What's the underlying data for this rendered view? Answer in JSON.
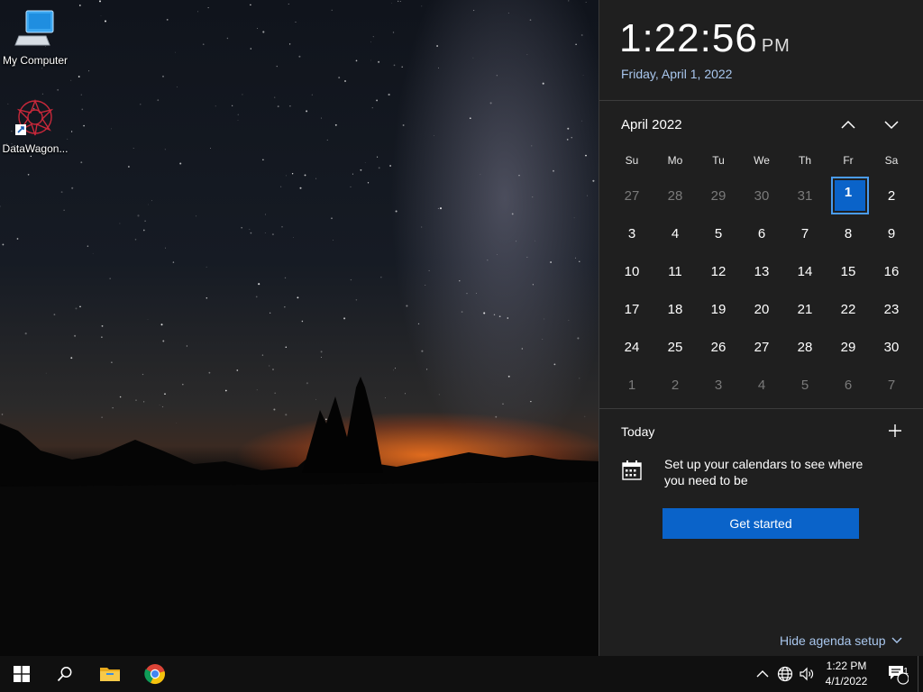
{
  "desktop": {
    "icons": [
      {
        "label": "My Computer",
        "icon": "computer-icon"
      },
      {
        "label": "DataWagon...",
        "icon": "datawagon-icon"
      }
    ]
  },
  "flyout": {
    "time": "1:22:56",
    "ampm": "PM",
    "date_long": "Friday, April 1, 2022",
    "month_label": "April 2022",
    "days_of_week": [
      "Su",
      "Mo",
      "Tu",
      "We",
      "Th",
      "Fr",
      "Sa"
    ],
    "weeks": [
      [
        {
          "d": "27",
          "m": true
        },
        {
          "d": "28",
          "m": true
        },
        {
          "d": "29",
          "m": true
        },
        {
          "d": "30",
          "m": true
        },
        {
          "d": "31",
          "m": true
        },
        {
          "d": "1",
          "t": true
        },
        {
          "d": "2"
        }
      ],
      [
        {
          "d": "3"
        },
        {
          "d": "4"
        },
        {
          "d": "5"
        },
        {
          "d": "6"
        },
        {
          "d": "7"
        },
        {
          "d": "8"
        },
        {
          "d": "9"
        }
      ],
      [
        {
          "d": "10"
        },
        {
          "d": "11"
        },
        {
          "d": "12"
        },
        {
          "d": "13"
        },
        {
          "d": "14"
        },
        {
          "d": "15"
        },
        {
          "d": "16"
        }
      ],
      [
        {
          "d": "17"
        },
        {
          "d": "18"
        },
        {
          "d": "19"
        },
        {
          "d": "20"
        },
        {
          "d": "21"
        },
        {
          "d": "22"
        },
        {
          "d": "23"
        }
      ],
      [
        {
          "d": "24"
        },
        {
          "d": "25"
        },
        {
          "d": "26"
        },
        {
          "d": "27"
        },
        {
          "d": "28"
        },
        {
          "d": "29"
        },
        {
          "d": "30"
        }
      ],
      [
        {
          "d": "1",
          "m": true
        },
        {
          "d": "2",
          "m": true
        },
        {
          "d": "3",
          "m": true
        },
        {
          "d": "4",
          "m": true
        },
        {
          "d": "5",
          "m": true
        },
        {
          "d": "6",
          "m": true
        },
        {
          "d": "7",
          "m": true
        }
      ]
    ],
    "agenda": {
      "title": "Today",
      "message": "Set up your calendars to see where you need to be",
      "button": "Get started",
      "hide_link": "Hide agenda setup"
    }
  },
  "taskbar": {
    "items": [
      "start-icon",
      "search-icon",
      "file-explorer-icon",
      "chrome-icon"
    ],
    "tray": {
      "time": "1:22 PM",
      "date": "4/1/2022",
      "notification_count": "1"
    }
  },
  "colors": {
    "accent": "#0a63c9",
    "link": "#a9c7ee",
    "flyout_bg": "#1f1f1f",
    "taskbar_bg": "#101010"
  }
}
